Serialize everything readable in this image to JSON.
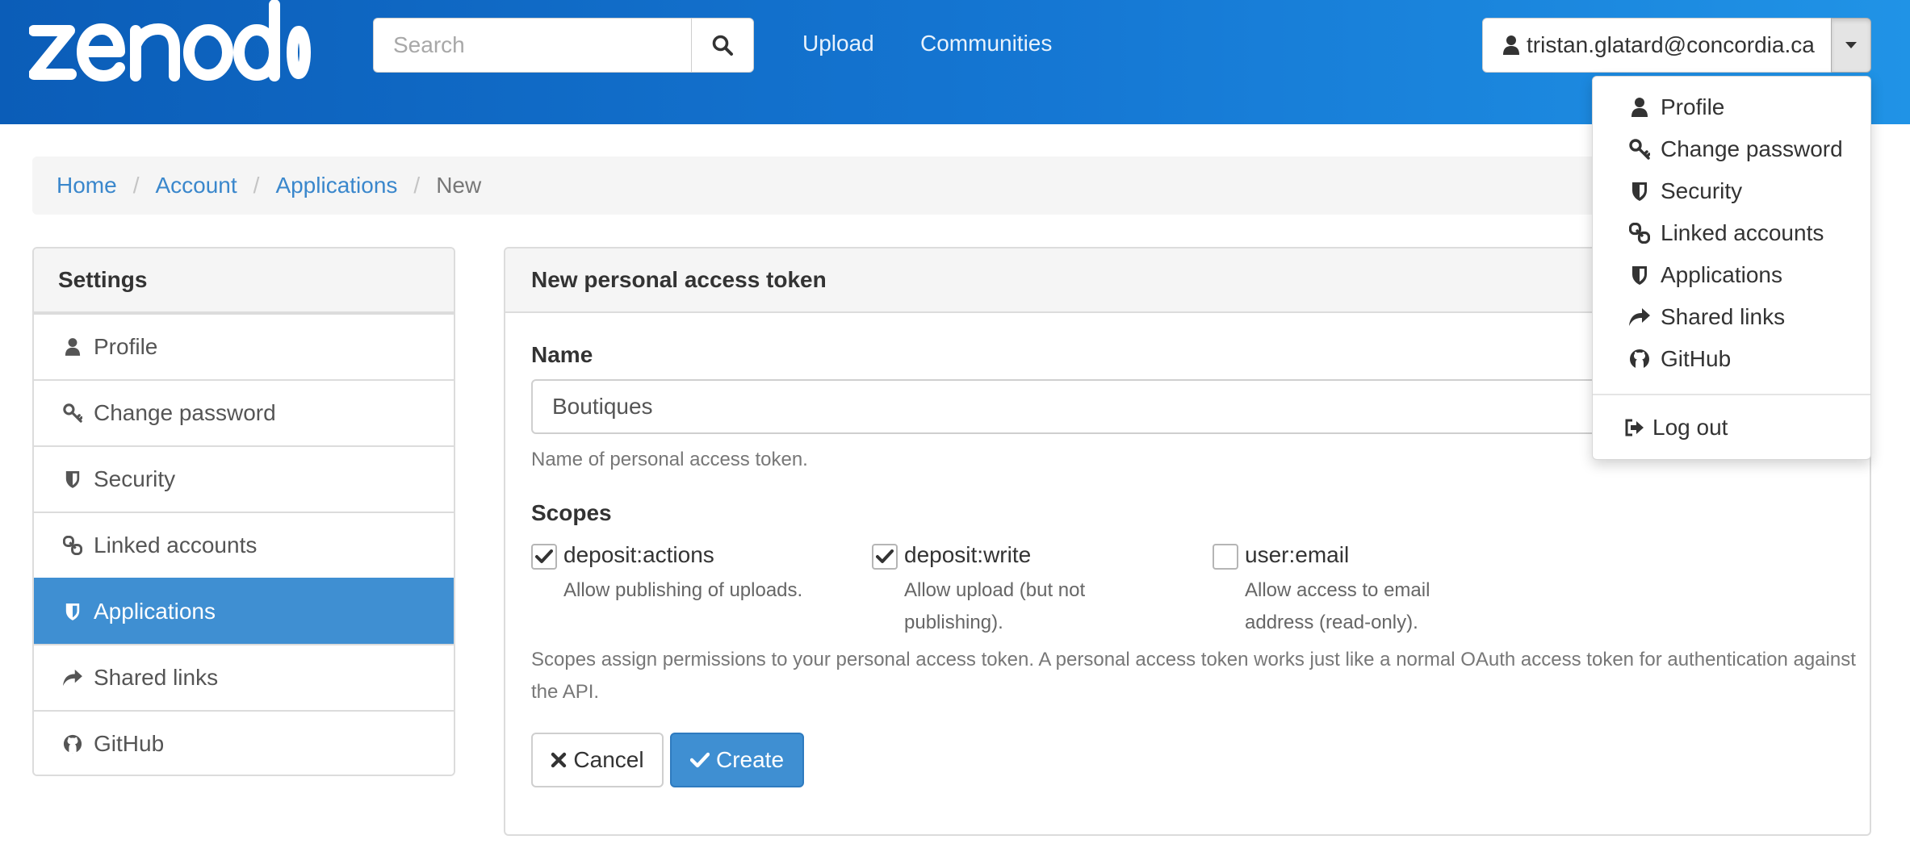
{
  "header": {
    "logo_text": "zenodo",
    "search": {
      "placeholder": "Search",
      "value": ""
    },
    "nav": [
      {
        "label": "Upload"
      },
      {
        "label": "Communities"
      }
    ],
    "user": {
      "email": "tristan.glatard@concordia.ca"
    }
  },
  "user_menu": {
    "items": [
      {
        "label": "Profile",
        "icon": "user-icon"
      },
      {
        "label": "Change password",
        "icon": "key-icon"
      },
      {
        "label": "Security",
        "icon": "shield-icon"
      },
      {
        "label": "Linked accounts",
        "icon": "link-icon"
      },
      {
        "label": "Applications",
        "icon": "shield-icon"
      },
      {
        "label": "Shared links",
        "icon": "share-icon"
      },
      {
        "label": "GitHub",
        "icon": "github-icon"
      }
    ],
    "logout": {
      "label": "Log out",
      "icon": "sign-out-icon"
    }
  },
  "breadcrumb": {
    "items": [
      {
        "label": "Home"
      },
      {
        "label": "Account"
      },
      {
        "label": "Applications"
      }
    ],
    "active": "New"
  },
  "sidebar": {
    "heading": "Settings",
    "items": [
      {
        "label": "Profile",
        "icon": "user-icon"
      },
      {
        "label": "Change password",
        "icon": "key-icon"
      },
      {
        "label": "Security",
        "icon": "shield-icon"
      },
      {
        "label": "Linked accounts",
        "icon": "link-icon"
      },
      {
        "label": "Applications",
        "icon": "shield-icon",
        "active": true
      },
      {
        "label": "Shared links",
        "icon": "share-icon"
      },
      {
        "label": "GitHub",
        "icon": "github-icon"
      }
    ]
  },
  "form": {
    "title": "New personal access token",
    "name_label": "Name",
    "name_value": "Boutiques",
    "name_help": "Name of personal access token.",
    "scopes_label": "Scopes",
    "scopes": [
      {
        "name": "deposit:actions",
        "desc_lines": [
          "Allow publishing of uploads."
        ],
        "checked": true
      },
      {
        "name": "deposit:write",
        "desc_lines": [
          "Allow upload (but not",
          "publishing)."
        ],
        "checked": true
      },
      {
        "name": "user:email",
        "desc_lines": [
          "Allow access to email",
          "address (read-only)."
        ],
        "checked": false
      }
    ],
    "scopes_help_lines": [
      "Scopes assign permissions to your personal access token. A personal access token works just like a normal OAuth access token for authentication against",
      "the API."
    ],
    "cancel_label": "Cancel",
    "create_label": "Create"
  },
  "colors": {
    "header_start": "#0b5db8",
    "header_end": "#2093e6",
    "accent": "#3f8fd2",
    "link": "#3a87cc"
  }
}
